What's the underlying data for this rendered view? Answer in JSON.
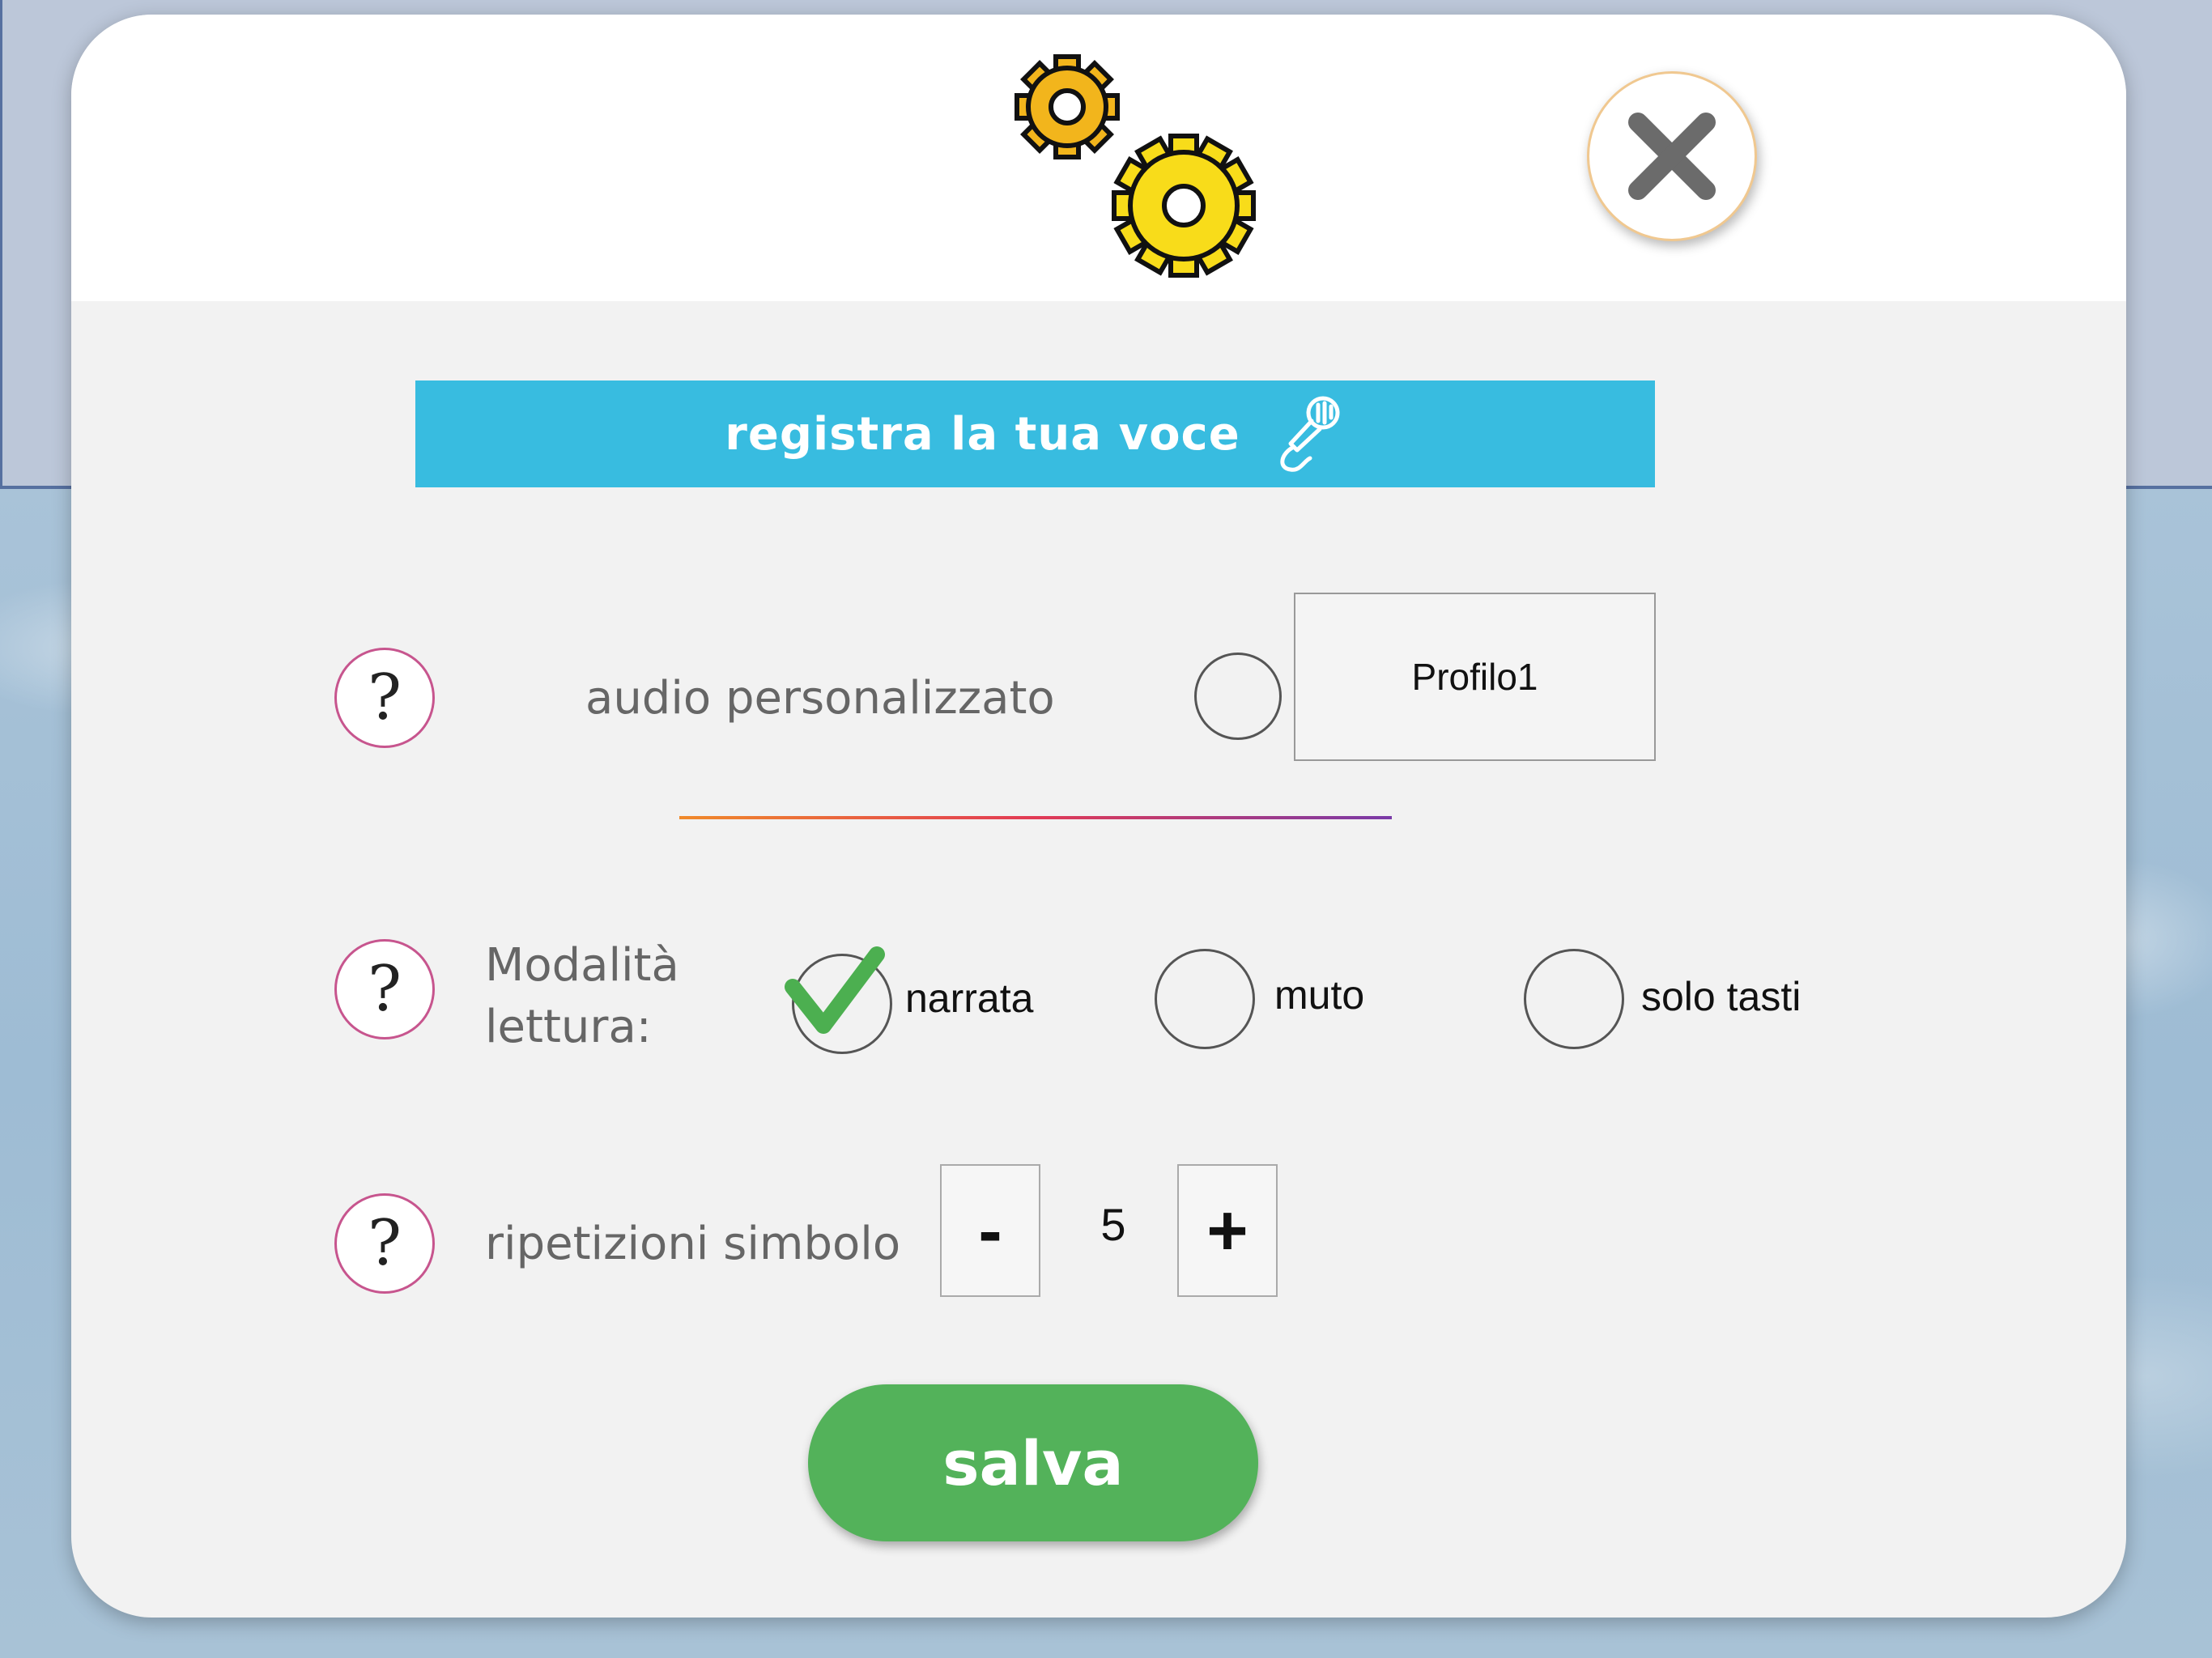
{
  "header": {
    "settings_icon": "gears-icon",
    "close_icon": "close-icon"
  },
  "record": {
    "label": "registra la tua voce",
    "icon": "microphone-icon"
  },
  "custom_audio": {
    "label": "audio personalizzato",
    "checked": false,
    "profile": "Profilo1"
  },
  "reading_mode": {
    "label_line1": "Modalità",
    "label_line2": "lettura:",
    "options": [
      {
        "label": "narrata",
        "selected": true
      },
      {
        "label": "muto",
        "selected": false
      },
      {
        "label": "solo tasti",
        "selected": false
      }
    ]
  },
  "repetitions": {
    "label": "ripetizioni simbolo",
    "minus": "-",
    "value": "5",
    "plus": "+"
  },
  "help_symbol": "?",
  "save_label": "salva",
  "colors": {
    "record_bar": "#38bce0",
    "save_button": "#53b25a",
    "check": "#4caf50",
    "gear_small": "#f2b51c",
    "gear_large": "#f8dc1a"
  }
}
